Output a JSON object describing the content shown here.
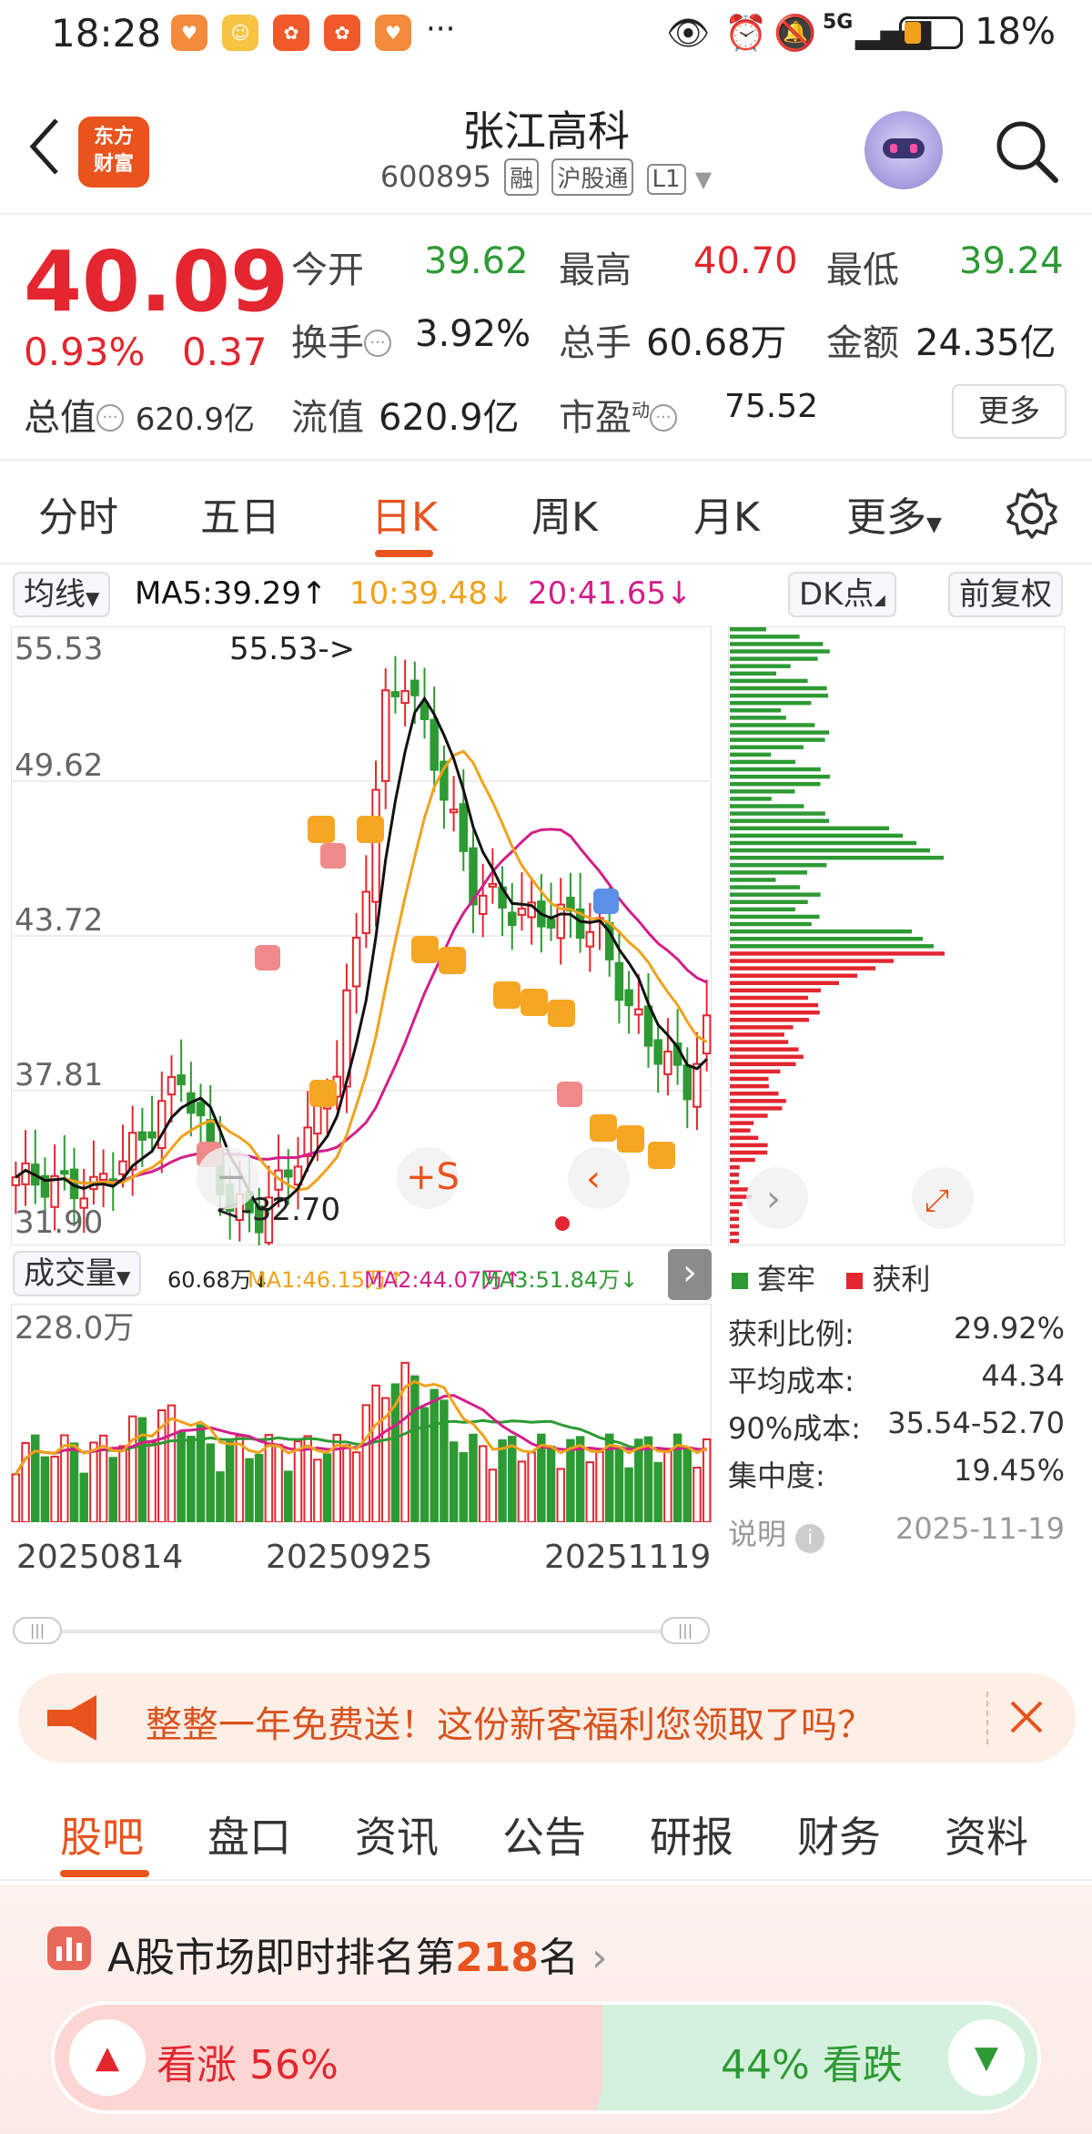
{
  "status_bar": {
    "time": "18:28",
    "ellipsis": "···",
    "network": "5G",
    "battery": "18%"
  },
  "header": {
    "stock_name": "张江高科",
    "stock_code": "600895",
    "tags": [
      "融",
      "沪股通",
      "L1"
    ],
    "brand_logo_text": "东方财富"
  },
  "quote": {
    "price": "40.09",
    "change_pct": "0.93%",
    "change": "0.37",
    "rows": [
      {
        "label": "今开",
        "value": "39.62",
        "color": "down"
      },
      {
        "label": "最高",
        "value": "40.70",
        "color": "up"
      },
      {
        "label": "最低",
        "value": "39.24",
        "color": "down"
      },
      {
        "label": "换手",
        "value": "3.92%",
        "color": "neu"
      },
      {
        "label": "总手",
        "value": "60.68万",
        "color": "neu"
      },
      {
        "label": "金额",
        "value": "24.35亿",
        "color": "neu"
      },
      {
        "label": "流值",
        "value": "620.9亿",
        "color": "neu"
      },
      {
        "label": "市盈",
        "value": "75.52",
        "color": "neu"
      }
    ],
    "total_value_label": "总值",
    "total_value": "620.9亿",
    "pe_superscript": "动",
    "more_button": "更多"
  },
  "period_tabs": [
    "分时",
    "五日",
    "日K",
    "周K",
    "月K",
    "更多"
  ],
  "period_active_index": 2,
  "ma_row": {
    "selector": "均线",
    "ma5": "MA5:39.29↑",
    "ma10": "10:39.48↓",
    "ma20": "20:41.65↓",
    "dk_button": "DK点",
    "adjust_button": "前复权"
  },
  "kline": {
    "y_ticks": [
      "55.53",
      "49.62",
      "43.72",
      "37.81",
      "31.90"
    ],
    "high_label": "55.53->",
    "low_label": "<-32.70"
  },
  "chip_legend": {
    "trapped": "套牢",
    "profit": "获利"
  },
  "volume": {
    "selector": "成交量",
    "vol": "60.68万↓",
    "ma1": "MA1:46.15万↑",
    "ma2": "MA2:44.07万↑",
    "ma3": "MA3:51.84万↓",
    "y_max": "228.0万"
  },
  "dates": [
    "20250814",
    "20250925",
    "20251119"
  ],
  "chip_stats": {
    "rows": [
      {
        "label": "获利比例:",
        "value": "29.92%"
      },
      {
        "label": "平均成本:",
        "value": "44.34"
      },
      {
        "label": "90%成本:",
        "value": "35.54-52.70"
      },
      {
        "label": "集中度:",
        "value": "19.45%"
      }
    ],
    "note_label": "说明",
    "date": "2025-11-19"
  },
  "ad_banner": {
    "text": "整整一年免费送！这份新客福利您领取了吗？"
  },
  "bottom_tabs": [
    "股吧",
    "盘口",
    "资讯",
    "公告",
    "研报",
    "财务",
    "资料"
  ],
  "rank": {
    "prefix": "A股市场即时排名第",
    "number": "218",
    "suffix": "名"
  },
  "vote": {
    "up": "看涨 56%",
    "down": "44% 看跌"
  },
  "colors": {
    "accent": "#e8531e",
    "up": "#e3262f",
    "down": "#2d9a33",
    "ma5": "#111111",
    "ma10": "#f0a21b",
    "ma20": "#d31f8a"
  }
}
